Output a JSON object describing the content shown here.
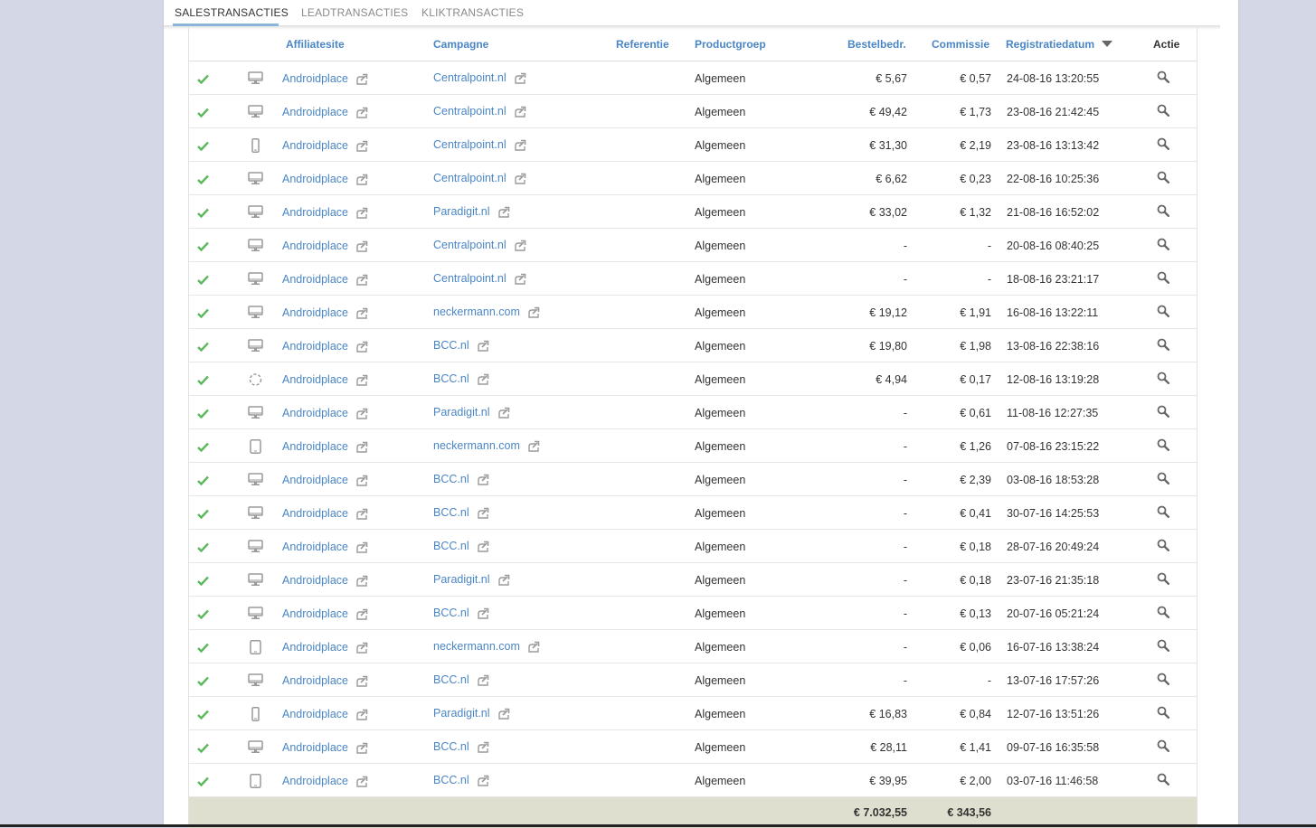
{
  "tabs": [
    {
      "label": "SALESTRANSACTIES",
      "active": true
    },
    {
      "label": "LEADTRANSACTIES",
      "active": false
    },
    {
      "label": "KLIKTRANSACTIES",
      "active": false
    }
  ],
  "columns": {
    "affiliatesite": "Affiliatesite",
    "campagne": "Campagne",
    "referentie": "Referentie",
    "productgroep": "Productgroep",
    "bestelbedrag": "Bestelbedr.",
    "commissie": "Commissie",
    "registratiedatum": "Registratiedatum",
    "actie": "Actie"
  },
  "colors": {
    "link": "#4a86c5",
    "check": "#5cb85c",
    "icon": "#9a9a9a",
    "footer": "#dedfcf"
  },
  "rows": [
    {
      "status": "approved",
      "device": "desktop",
      "site": "Androidplace",
      "campaign": "Centralpoint.nl",
      "ref": "",
      "group": "Algemeen",
      "order": "€ 5,67",
      "commission": "€ 0,57",
      "date": "24-08-16 13:20:55"
    },
    {
      "status": "approved",
      "device": "desktop",
      "site": "Androidplace",
      "campaign": "Centralpoint.nl",
      "ref": "",
      "group": "Algemeen",
      "order": "€ 49,42",
      "commission": "€ 1,73",
      "date": "23-08-16 21:42:45"
    },
    {
      "status": "approved",
      "device": "phone",
      "site": "Androidplace",
      "campaign": "Centralpoint.nl",
      "ref": "",
      "group": "Algemeen",
      "order": "€ 31,30",
      "commission": "€ 2,19",
      "date": "23-08-16 13:13:42"
    },
    {
      "status": "approved",
      "device": "desktop",
      "site": "Androidplace",
      "campaign": "Centralpoint.nl",
      "ref": "",
      "group": "Algemeen",
      "order": "€ 6,62",
      "commission": "€ 0,23",
      "date": "22-08-16 10:25:36"
    },
    {
      "status": "approved",
      "device": "desktop",
      "site": "Androidplace",
      "campaign": "Paradigit.nl",
      "ref": "",
      "group": "Algemeen",
      "order": "€ 33,02",
      "commission": "€ 1,32",
      "date": "21-08-16 16:52:02"
    },
    {
      "status": "approved",
      "device": "desktop",
      "site": "Androidplace",
      "campaign": "Centralpoint.nl",
      "ref": "",
      "group": "Algemeen",
      "order": "-",
      "commission": "-",
      "date": "20-08-16 08:40:25"
    },
    {
      "status": "approved",
      "device": "desktop",
      "site": "Androidplace",
      "campaign": "Centralpoint.nl",
      "ref": "",
      "group": "Algemeen",
      "order": "-",
      "commission": "-",
      "date": "18-08-16 23:21:17"
    },
    {
      "status": "approved",
      "device": "desktop",
      "site": "Androidplace",
      "campaign": "neckermann.com",
      "ref": "",
      "group": "Algemeen",
      "order": "€ 19,12",
      "commission": "€ 1,91",
      "date": "16-08-16 13:22:11"
    },
    {
      "status": "approved",
      "device": "desktop",
      "site": "Androidplace",
      "campaign": "BCC.nl",
      "ref": "",
      "group": "Algemeen",
      "order": "€ 19,80",
      "commission": "€ 1,98",
      "date": "13-08-16 22:38:16"
    },
    {
      "status": "approved",
      "device": "unknown",
      "site": "Androidplace",
      "campaign": "BCC.nl",
      "ref": "",
      "group": "Algemeen",
      "order": "€ 4,94",
      "commission": "€ 0,17",
      "date": "12-08-16 13:19:28"
    },
    {
      "status": "approved",
      "device": "desktop",
      "site": "Androidplace",
      "campaign": "Paradigit.nl",
      "ref": "",
      "group": "Algemeen",
      "order": "-",
      "commission": "€ 0,61",
      "date": "11-08-16 12:27:35"
    },
    {
      "status": "approved",
      "device": "tablet",
      "site": "Androidplace",
      "campaign": "neckermann.com",
      "ref": "",
      "group": "Algemeen",
      "order": "-",
      "commission": "€ 1,26",
      "date": "07-08-16 23:15:22"
    },
    {
      "status": "approved",
      "device": "desktop",
      "site": "Androidplace",
      "campaign": "BCC.nl",
      "ref": "",
      "group": "Algemeen",
      "order": "-",
      "commission": "€ 2,39",
      "date": "03-08-16 18:53:28"
    },
    {
      "status": "approved",
      "device": "desktop",
      "site": "Androidplace",
      "campaign": "BCC.nl",
      "ref": "",
      "group": "Algemeen",
      "order": "-",
      "commission": "€ 0,41",
      "date": "30-07-16 14:25:53"
    },
    {
      "status": "approved",
      "device": "desktop",
      "site": "Androidplace",
      "campaign": "BCC.nl",
      "ref": "",
      "group": "Algemeen",
      "order": "-",
      "commission": "€ 0,18",
      "date": "28-07-16 20:49:24"
    },
    {
      "status": "approved",
      "device": "desktop",
      "site": "Androidplace",
      "campaign": "Paradigit.nl",
      "ref": "",
      "group": "Algemeen",
      "order": "-",
      "commission": "€ 0,18",
      "date": "23-07-16 21:35:18"
    },
    {
      "status": "approved",
      "device": "desktop",
      "site": "Androidplace",
      "campaign": "BCC.nl",
      "ref": "",
      "group": "Algemeen",
      "order": "-",
      "commission": "€ 0,13",
      "date": "20-07-16 05:21:24"
    },
    {
      "status": "approved",
      "device": "tablet",
      "site": "Androidplace",
      "campaign": "neckermann.com",
      "ref": "",
      "group": "Algemeen",
      "order": "-",
      "commission": "€ 0,06",
      "date": "16-07-16 13:38:24"
    },
    {
      "status": "approved",
      "device": "desktop",
      "site": "Androidplace",
      "campaign": "BCC.nl",
      "ref": "",
      "group": "Algemeen",
      "order": "-",
      "commission": "-",
      "date": "13-07-16 17:57:26"
    },
    {
      "status": "approved",
      "device": "phone",
      "site": "Androidplace",
      "campaign": "Paradigit.nl",
      "ref": "",
      "group": "Algemeen",
      "order": "€ 16,83",
      "commission": "€ 0,84",
      "date": "12-07-16 13:51:26"
    },
    {
      "status": "approved",
      "device": "desktop",
      "site": "Androidplace",
      "campaign": "BCC.nl",
      "ref": "",
      "group": "Algemeen",
      "order": "€ 28,11",
      "commission": "€ 1,41",
      "date": "09-07-16 16:35:58"
    },
    {
      "status": "approved",
      "device": "tablet",
      "site": "Androidplace",
      "campaign": "BCC.nl",
      "ref": "",
      "group": "Algemeen",
      "order": "€ 39,95",
      "commission": "€ 2,00",
      "date": "03-07-16 11:46:58"
    }
  ],
  "totals": {
    "order": "€ 7.032,55",
    "commission": "€ 343,56"
  }
}
